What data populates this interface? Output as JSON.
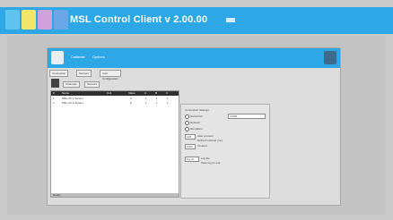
{
  "app": {
    "title": "MSL Control Client  v 2.00.00",
    "logo_colors": [
      "#5fc3ee",
      "#f1e56a",
      "#cfa3d9",
      "#6aa7e8"
    ]
  },
  "inner": {
    "menu": [
      "Calibrate",
      "Options"
    ],
    "subtabs": [
      "Connection",
      "Sensors",
      "Auto Configuration"
    ],
    "left_tabs": [
      "Channels",
      "Sensors"
    ]
  },
  "grid": {
    "headers": [
      "#",
      "Name",
      "Unit",
      "Value",
      "A",
      "B",
      "C"
    ],
    "rows": [
      [
        "1",
        "MSL-Ch 1 Sensor",
        "",
        "0",
        "1",
        "1",
        "1"
      ],
      [
        "2",
        "MSL-Ch 2 Sensor",
        "",
        "0",
        "1",
        "1",
        "1"
      ]
    ],
    "footer": "Ready"
  },
  "settings": {
    "group": "Connection Settings",
    "radio1": "Serial Port",
    "radio1_value": "COM1",
    "radio2": "Network",
    "radio3": "Simulation",
    "label_a": "Auto connect",
    "value_a": "100",
    "label_a2": "Refresh interval (ms)",
    "value_b": "1000",
    "label_b": "Timeout",
    "label_c": "Log file",
    "value_c": "log.txt",
    "label_c2": "Save log on exit"
  }
}
